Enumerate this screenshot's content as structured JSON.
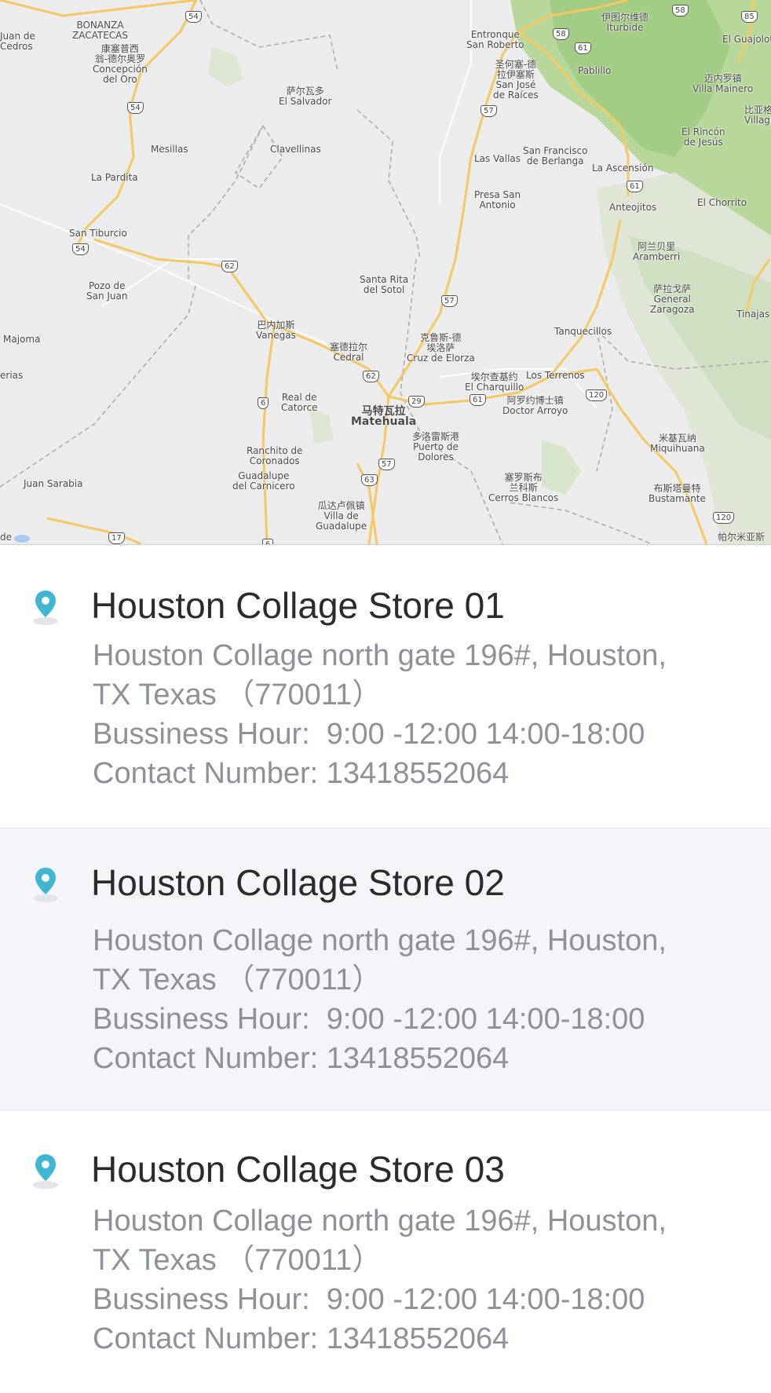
{
  "map": {
    "places": [
      {
        "id": "bonanza",
        "text": "BONANZA\nZACATECAS"
      },
      {
        "id": "juan-de-cedros",
        "text": "Juan de\nCedros"
      },
      {
        "id": "concepcion",
        "text": "康塞普西\n翁-德尔奥罗\nConcepción\ndel Oro"
      },
      {
        "id": "el-salvador",
        "text": "萨尔瓦多\nEl Salvador"
      },
      {
        "id": "mesillas",
        "text": "Mesillas"
      },
      {
        "id": "clavellinas",
        "text": "Clavellinas"
      },
      {
        "id": "la-pardita",
        "text": "La Pardita"
      },
      {
        "id": "san-tiburcio",
        "text": "San Tiburcio"
      },
      {
        "id": "pozo-de-san-juan",
        "text": "Pozo de\nSan Juan"
      },
      {
        "id": "majoma",
        "text": "Majoma"
      },
      {
        "id": "erias",
        "text": "erias"
      },
      {
        "id": "juan-sarabia",
        "text": "Juan Sarabia"
      },
      {
        "id": "vanegas",
        "text": "巴内加斯\nVanegas"
      },
      {
        "id": "santa-rita",
        "text": "Santa Rita\ndel Sotol"
      },
      {
        "id": "cedral",
        "text": "塞德拉尔\nCedral"
      },
      {
        "id": "cruz-de-elorza",
        "text": "克鲁斯-德\n埃洛萨\nCruz de Elorza"
      },
      {
        "id": "real-de-catorce",
        "text": "Real de\nCatorce"
      },
      {
        "id": "matehuala",
        "text": "马特瓦拉\nMatehuala"
      },
      {
        "id": "puerto-de-dolores",
        "text": "多洛雷斯港\nPuerto de\nDolores"
      },
      {
        "id": "ranchito",
        "text": "Ranchito de\nCoronados"
      },
      {
        "id": "guadalupe-carnicero",
        "text": "Guadalupe\ndel Carnicero"
      },
      {
        "id": "villa-de-guadalupe",
        "text": "瓜达卢佩镇\nVilla de\nGuadalupe"
      },
      {
        "id": "entronque",
        "text": "Entronque\nSan Roberto"
      },
      {
        "id": "san-jose-de-raices",
        "text": "圣何塞-德\n拉伊塞斯\nSan José\nde Raíces"
      },
      {
        "id": "iturbide",
        "text": "伊图尔维德\nIturbide"
      },
      {
        "id": "pablillo",
        "text": "Pablillo"
      },
      {
        "id": "el-guajolote",
        "text": "El Guajolot"
      },
      {
        "id": "villa-mainero",
        "text": "迈内罗镇\nVilla Mainero"
      },
      {
        "id": "villagran",
        "text": "比亚格\nVillagr"
      },
      {
        "id": "el-rincon",
        "text": "El Rincón\nde Jesús"
      },
      {
        "id": "san-francisco-berlanga",
        "text": "San Francisco\nde Berlanga"
      },
      {
        "id": "la-ascension",
        "text": "La Ascensión"
      },
      {
        "id": "las-vallas",
        "text": "Las Vallas"
      },
      {
        "id": "presa-san-antonio",
        "text": "Presa San\nAntonio"
      },
      {
        "id": "anteojitos",
        "text": "Anteojitos"
      },
      {
        "id": "el-chorrito",
        "text": "El Chorrito"
      },
      {
        "id": "aramberri",
        "text": "阿兰贝里\nAramberri"
      },
      {
        "id": "zaragoza",
        "text": "萨拉戈萨\nGeneral\nZaragoza"
      },
      {
        "id": "tinajas",
        "text": "Tinajas"
      },
      {
        "id": "tanquecillos",
        "text": "Tanquecillos"
      },
      {
        "id": "el-charquillo",
        "text": "埃尔查基约\nEl Charquillo"
      },
      {
        "id": "los-terrenos",
        "text": "Los Terrenos"
      },
      {
        "id": "doctor-arroyo",
        "text": "阿罗约博士镇\nDoctor Arroyo"
      },
      {
        "id": "miquihuana",
        "text": "米基瓦纳\nMiquihuana"
      },
      {
        "id": "cerros-blancos",
        "text": "塞罗斯布\n兰科斯\nCerros Blancos"
      },
      {
        "id": "bustamante",
        "text": "布斯塔曼特\nBustamante"
      },
      {
        "id": "palmillas",
        "text": "帕尔米亚斯"
      },
      {
        "id": "ide",
        "text": "de"
      }
    ],
    "shields": [
      "54",
      "54",
      "54",
      "62",
      "62",
      "6",
      "63",
      "57",
      "57",
      "57",
      "29",
      "61",
      "61",
      "61",
      "58",
      "58",
      "85",
      "120",
      "120",
      "17",
      "6"
    ]
  },
  "stores": [
    {
      "name": "Houston Collage Store 01",
      "address_line1": "Houston Collage north gate 196#, Houston,",
      "address_line2": "TX Texas （770011）",
      "hours": "Bussiness Hour:  9:00 -12:00 14:00-18:00",
      "contact": "Contact Number: 13418552064",
      "pin_color": "#3fb6d3"
    },
    {
      "name": "Houston Collage Store 02",
      "address_line1": "Houston Collage north gate 196#, Houston,",
      "address_line2": "TX Texas （770011）",
      "hours": "Bussiness Hour:  9:00 -12:00 14:00-18:00",
      "contact": "Contact Number: 13418552064",
      "pin_color": "#3fb6d3"
    },
    {
      "name": "Houston Collage Store 03",
      "address_line1": "Houston Collage north gate 196#, Houston,",
      "address_line2": "TX Texas （770011）",
      "hours": "Bussiness Hour:  9:00 -12:00 14:00-18:00",
      "contact": "Contact Number: 13418552064",
      "pin_color": "#3fb6d3"
    }
  ],
  "colors": {
    "selected_row_bg": "#f3f5f8",
    "title_text": "#2b2b2b",
    "detail_text": "#8e9298",
    "road": "#f4c862",
    "vegetation": "#b6d79b"
  }
}
